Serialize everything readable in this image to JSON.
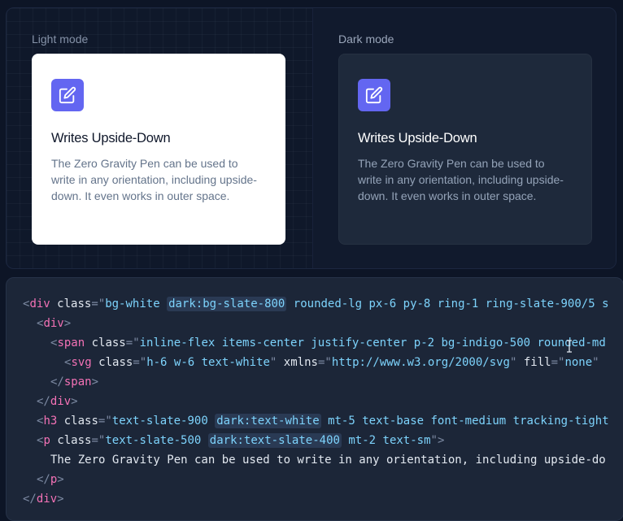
{
  "preview": {
    "light_label": "Light mode",
    "dark_label": "Dark mode",
    "card": {
      "title": "Writes Upside-Down",
      "description": "The Zero Gravity Pen can be used to write in any orientation, including upside-down. It even works in outer space.",
      "icon": "pencil-square-icon"
    }
  },
  "colors": {
    "accent": "#6366f1",
    "light_card_bg": "#ffffff",
    "dark_card_bg": "#1e293b",
    "tag": "#f472b6",
    "string": "#7dd3fc"
  },
  "code": {
    "line1": {
      "open": "<",
      "tag": "div",
      "attr": "class",
      "eq": "=",
      "q1": "\"",
      "v1": "bg-white ",
      "hl": "dark:bg-slate-800",
      "v2": " rounded-lg px-6 py-8 ring-1 ring-slate-900/5 s"
    },
    "line2": {
      "open": "<",
      "tag": "div",
      "close": ">"
    },
    "line3": {
      "open": "<",
      "tag": "span",
      "attr": "class",
      "eq": "=",
      "q1": "\"",
      "v": "inline-flex items-center justify-center p-2 bg-indigo-500 rounded-md"
    },
    "line4": {
      "open": "<",
      "tag": "svg",
      "attr1": "class",
      "eq": "=",
      "q": "\"",
      "v1": "h-6 w-6 text-white",
      "attr2": "xmlns",
      "v2": "http://www.w3.org/2000/svg",
      "attr3": "fill",
      "v3": "none"
    },
    "line5": {
      "open": "</",
      "tag": "span",
      "close": ">"
    },
    "line6": {
      "open": "</",
      "tag": "div",
      "close": ">"
    },
    "line7": {
      "open": "<",
      "tag": "h3",
      "attr": "class",
      "eq": "=",
      "q": "\"",
      "v1": "text-slate-900 ",
      "hl": "dark:text-white",
      "v2": " mt-5 text-base font-medium tracking-tight"
    },
    "line8": {
      "open": "<",
      "tag": "p",
      "attr": "class",
      "eq": "=",
      "q": "\"",
      "v1": "text-slate-500 ",
      "hl": "dark:text-slate-400",
      "v2": " mt-2 text-sm",
      "close": ">"
    },
    "line9": {
      "text": "The Zero Gravity Pen can be used to write in any orientation, including upside-do"
    },
    "line10": {
      "open": "</",
      "tag": "p",
      "close": ">"
    },
    "line11": {
      "open": "</",
      "tag": "div",
      "close": ">"
    }
  }
}
